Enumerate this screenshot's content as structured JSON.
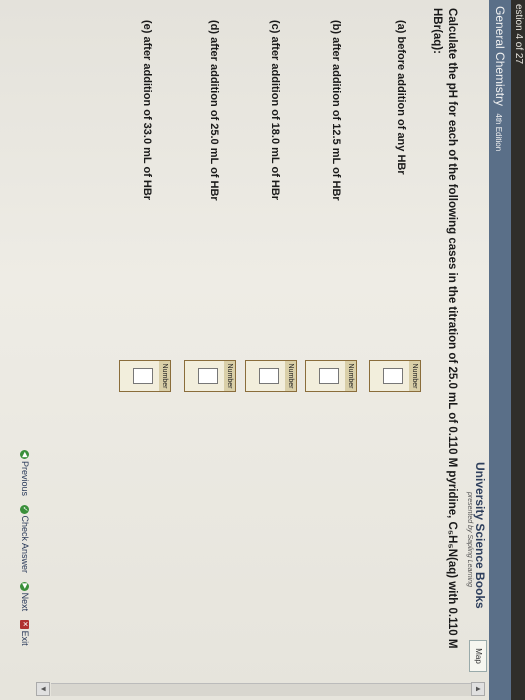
{
  "question_counter": "estion 4 of 27",
  "app": {
    "title": "General Chemistry",
    "edition": "4th Edition"
  },
  "brand": {
    "name": "University Science Books",
    "sub": "presented by Sapling Learning"
  },
  "map_button": "Map",
  "question_text": "Calculate the pH for each of the following cases in the titration of 25.0 mL of 0.110 M pyridine, C₅H₅N(aq) with 0.110 M HBr(aq):",
  "answer_label": "Number",
  "parts": [
    {
      "label": "(a) before addition of any HBr"
    },
    {
      "label": "(b) after addition of 12.5 mL of HBr"
    },
    {
      "label": "(c) after addition of 18.0 mL of HBr"
    },
    {
      "label": "(d) after addition of 25.0 mL of HBr"
    },
    {
      "label": "(e) after addition of 33.0 mL of HBr"
    }
  ],
  "footer": {
    "previous": "Previous",
    "check": "Check Answer",
    "next": "Next",
    "exit": "Exit"
  }
}
